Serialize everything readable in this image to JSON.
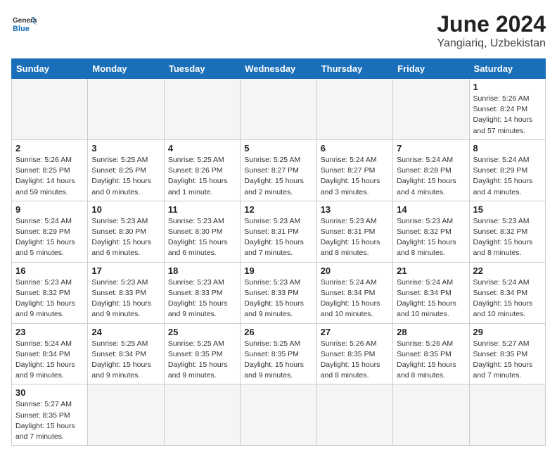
{
  "header": {
    "logo_general": "General",
    "logo_blue": "Blue",
    "month_title": "June 2024",
    "location": "Yangiariq, Uzbekistan"
  },
  "days_of_week": [
    "Sunday",
    "Monday",
    "Tuesday",
    "Wednesday",
    "Thursday",
    "Friday",
    "Saturday"
  ],
  "weeks": [
    [
      {
        "day": "",
        "info": ""
      },
      {
        "day": "",
        "info": ""
      },
      {
        "day": "",
        "info": ""
      },
      {
        "day": "",
        "info": ""
      },
      {
        "day": "",
        "info": ""
      },
      {
        "day": "",
        "info": ""
      },
      {
        "day": "1",
        "info": "Sunrise: 5:26 AM\nSunset: 8:24 PM\nDaylight: 14 hours\nand 57 minutes."
      }
    ],
    [
      {
        "day": "2",
        "info": "Sunrise: 5:26 AM\nSunset: 8:25 PM\nDaylight: 14 hours\nand 59 minutes."
      },
      {
        "day": "3",
        "info": "Sunrise: 5:25 AM\nSunset: 8:25 PM\nDaylight: 15 hours\nand 0 minutes."
      },
      {
        "day": "4",
        "info": "Sunrise: 5:25 AM\nSunset: 8:26 PM\nDaylight: 15 hours\nand 1 minute."
      },
      {
        "day": "5",
        "info": "Sunrise: 5:25 AM\nSunset: 8:27 PM\nDaylight: 15 hours\nand 2 minutes."
      },
      {
        "day": "6",
        "info": "Sunrise: 5:24 AM\nSunset: 8:27 PM\nDaylight: 15 hours\nand 3 minutes."
      },
      {
        "day": "7",
        "info": "Sunrise: 5:24 AM\nSunset: 8:28 PM\nDaylight: 15 hours\nand 4 minutes."
      },
      {
        "day": "8",
        "info": "Sunrise: 5:24 AM\nSunset: 8:29 PM\nDaylight: 15 hours\nand 4 minutes."
      }
    ],
    [
      {
        "day": "9",
        "info": "Sunrise: 5:24 AM\nSunset: 8:29 PM\nDaylight: 15 hours\nand 5 minutes."
      },
      {
        "day": "10",
        "info": "Sunrise: 5:23 AM\nSunset: 8:30 PM\nDaylight: 15 hours\nand 6 minutes."
      },
      {
        "day": "11",
        "info": "Sunrise: 5:23 AM\nSunset: 8:30 PM\nDaylight: 15 hours\nand 6 minutes."
      },
      {
        "day": "12",
        "info": "Sunrise: 5:23 AM\nSunset: 8:31 PM\nDaylight: 15 hours\nand 7 minutes."
      },
      {
        "day": "13",
        "info": "Sunrise: 5:23 AM\nSunset: 8:31 PM\nDaylight: 15 hours\nand 8 minutes."
      },
      {
        "day": "14",
        "info": "Sunrise: 5:23 AM\nSunset: 8:32 PM\nDaylight: 15 hours\nand 8 minutes."
      },
      {
        "day": "15",
        "info": "Sunrise: 5:23 AM\nSunset: 8:32 PM\nDaylight: 15 hours\nand 8 minutes."
      }
    ],
    [
      {
        "day": "16",
        "info": "Sunrise: 5:23 AM\nSunset: 8:32 PM\nDaylight: 15 hours\nand 9 minutes."
      },
      {
        "day": "17",
        "info": "Sunrise: 5:23 AM\nSunset: 8:33 PM\nDaylight: 15 hours\nand 9 minutes."
      },
      {
        "day": "18",
        "info": "Sunrise: 5:23 AM\nSunset: 8:33 PM\nDaylight: 15 hours\nand 9 minutes."
      },
      {
        "day": "19",
        "info": "Sunrise: 5:23 AM\nSunset: 8:33 PM\nDaylight: 15 hours\nand 9 minutes."
      },
      {
        "day": "20",
        "info": "Sunrise: 5:24 AM\nSunset: 8:34 PM\nDaylight: 15 hours\nand 10 minutes."
      },
      {
        "day": "21",
        "info": "Sunrise: 5:24 AM\nSunset: 8:34 PM\nDaylight: 15 hours\nand 10 minutes."
      },
      {
        "day": "22",
        "info": "Sunrise: 5:24 AM\nSunset: 8:34 PM\nDaylight: 15 hours\nand 10 minutes."
      }
    ],
    [
      {
        "day": "23",
        "info": "Sunrise: 5:24 AM\nSunset: 8:34 PM\nDaylight: 15 hours\nand 9 minutes."
      },
      {
        "day": "24",
        "info": "Sunrise: 5:25 AM\nSunset: 8:34 PM\nDaylight: 15 hours\nand 9 minutes."
      },
      {
        "day": "25",
        "info": "Sunrise: 5:25 AM\nSunset: 8:35 PM\nDaylight: 15 hours\nand 9 minutes."
      },
      {
        "day": "26",
        "info": "Sunrise: 5:25 AM\nSunset: 8:35 PM\nDaylight: 15 hours\nand 9 minutes."
      },
      {
        "day": "27",
        "info": "Sunrise: 5:26 AM\nSunset: 8:35 PM\nDaylight: 15 hours\nand 8 minutes."
      },
      {
        "day": "28",
        "info": "Sunrise: 5:26 AM\nSunset: 8:35 PM\nDaylight: 15 hours\nand 8 minutes."
      },
      {
        "day": "29",
        "info": "Sunrise: 5:27 AM\nSunset: 8:35 PM\nDaylight: 15 hours\nand 7 minutes."
      }
    ],
    [
      {
        "day": "30",
        "info": "Sunrise: 5:27 AM\nSunset: 8:35 PM\nDaylight: 15 hours\nand 7 minutes."
      },
      {
        "day": "",
        "info": ""
      },
      {
        "day": "",
        "info": ""
      },
      {
        "day": "",
        "info": ""
      },
      {
        "day": "",
        "info": ""
      },
      {
        "day": "",
        "info": ""
      },
      {
        "day": "",
        "info": ""
      }
    ]
  ]
}
